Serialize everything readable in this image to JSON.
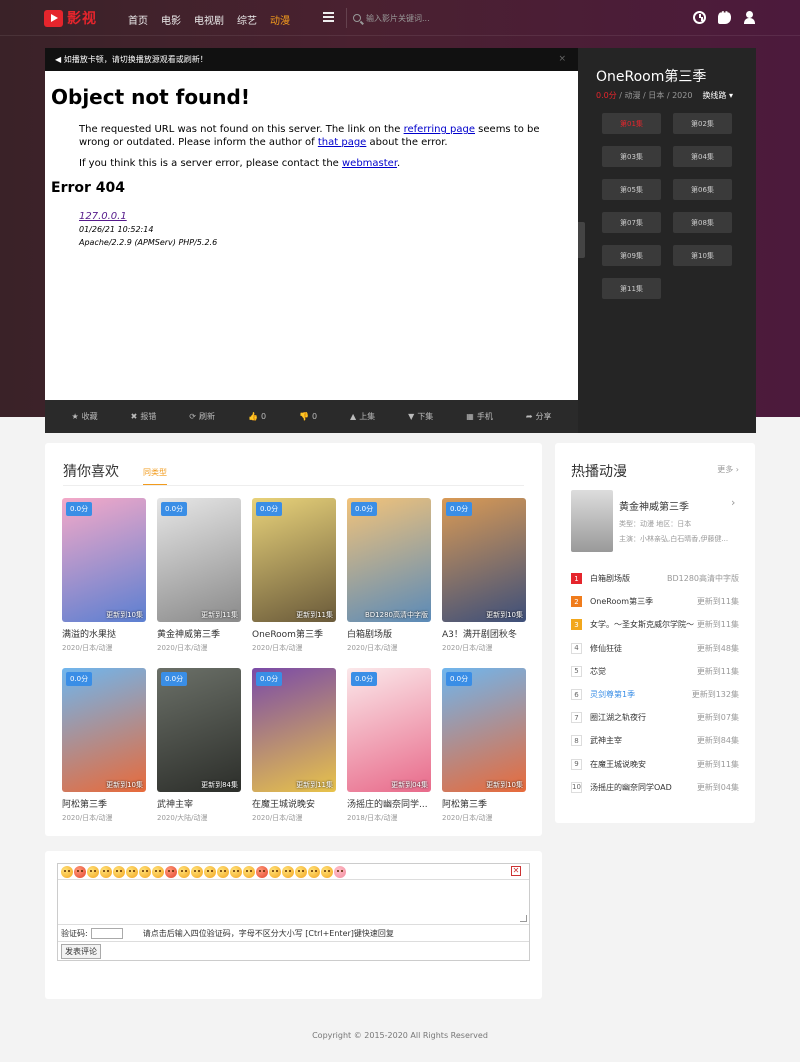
{
  "header": {
    "logo_text": "影视",
    "nav": [
      {
        "label": "首页",
        "active": false
      },
      {
        "label": "电影",
        "active": false
      },
      {
        "label": "电视剧",
        "active": false
      },
      {
        "label": "综艺",
        "active": false
      },
      {
        "label": "动漫",
        "active": true
      }
    ],
    "search_placeholder": "输入影片关键词..."
  },
  "player": {
    "notice": "◀ 如播放卡顿，请切换播放源观看或刷新！",
    "close": "×",
    "error": {
      "title": "Object not found!",
      "p1_a": "The requested URL was not found on this server. The link on the ",
      "p1_link1": "referring page",
      "p1_b": " seems to be wrong or outdated. Please inform the author of ",
      "p1_link2": "that page",
      "p1_c": " about the error.",
      "p2_a": "If you think this is a server error, please contact the ",
      "p2_link": "webmaster",
      "p2_b": ".",
      "code": "Error 404",
      "host": "127.0.0.1",
      "date": "01/26/21 10:52:14",
      "server": "Apache/2.2.9 (APMServ) PHP/5.2.6"
    },
    "toolbar": [
      {
        "icon": "star-icon",
        "glyph": "★",
        "label": "收藏"
      },
      {
        "icon": "warning-icon",
        "glyph": "✖",
        "label": "报错"
      },
      {
        "icon": "refresh-icon",
        "glyph": "⟳",
        "label": "刷新"
      },
      {
        "icon": "thumbs-up-icon",
        "glyph": "👍",
        "label": "0"
      },
      {
        "icon": "thumbs-down-icon",
        "glyph": "👎",
        "label": "0"
      },
      {
        "icon": "up-icon",
        "glyph": "▲",
        "label": "上集"
      },
      {
        "icon": "down-icon",
        "glyph": "▼",
        "label": "下集"
      },
      {
        "icon": "qrcode-icon",
        "glyph": "▦",
        "label": "手机"
      },
      {
        "icon": "share-icon",
        "glyph": "➦",
        "label": "分享"
      }
    ]
  },
  "episodes": {
    "title": "OneRoom第三季",
    "score": "0.0分",
    "meta": " / 动漫 / 日本 / 2020",
    "switch_label": "换线路 ▾",
    "items": [
      "第01集",
      "第02集",
      "第03集",
      "第04集",
      "第05集",
      "第06集",
      "第07集",
      "第08集",
      "第09集",
      "第10集",
      "第11集"
    ],
    "current_index": 0
  },
  "guess": {
    "title": "猜你喜欢",
    "tab": "同类型",
    "cards": [
      {
        "score": "0.0分",
        "update": "更新到10集",
        "name": "满溢的水果挞",
        "meta": "2020/日本/动漫",
        "colors": [
          "#f4a9c8",
          "#5b7fd1"
        ]
      },
      {
        "score": "0.0分",
        "update": "更新到11集",
        "name": "黄金神威第三季",
        "meta": "2020/日本/动漫",
        "colors": [
          "#e6e6e6",
          "#8a8a8a"
        ]
      },
      {
        "score": "0.0分",
        "update": "更新到11集",
        "name": "OneRoom第三季",
        "meta": "2020/日本/动漫",
        "colors": [
          "#e8d27a",
          "#6a5a3a"
        ]
      },
      {
        "score": "0.0分",
        "update": "BD1280高清中字版",
        "name": "白箱剧场版",
        "meta": "2020/日本/动漫",
        "colors": [
          "#f2c37a",
          "#5a8ab8"
        ]
      },
      {
        "score": "0.0分",
        "update": "更新到10集",
        "name": "A3！满开剧团秋冬",
        "meta": "2020/日本/动漫",
        "colors": [
          "#d99a55",
          "#3d4f7a"
        ]
      },
      {
        "score": "0.0分",
        "update": "更新到10集",
        "name": "阿松第三季",
        "meta": "2020/日本/动漫",
        "colors": [
          "#6fb6ee",
          "#e86a3a"
        ]
      },
      {
        "score": "0.0分",
        "update": "更新到84集",
        "name": "武神主宰",
        "meta": "2020/大陆/动漫",
        "colors": [
          "#6b7068",
          "#2c2e2a"
        ]
      },
      {
        "score": "0.0分",
        "update": "更新到11集",
        "name": "在魔王城说晚安",
        "meta": "2020/日本/动漫",
        "colors": [
          "#7a4aa8",
          "#e8c34a"
        ]
      },
      {
        "score": "0.0分",
        "update": "更新到04集",
        "name": "汤摇庄的幽奈同学...",
        "meta": "2018/日本/动漫",
        "colors": [
          "#fbe8ea",
          "#e86a8a"
        ]
      },
      {
        "score": "0.0分",
        "update": "更新到10集",
        "name": "阿松第三季",
        "meta": "2020/日本/动漫",
        "colors": [
          "#6fb6ee",
          "#e86a3a"
        ]
      }
    ]
  },
  "hot": {
    "title": "热播动漫",
    "more": "更多 ›",
    "featured": {
      "name": "黄金神威第三季",
      "arrow": "›",
      "line1": "类型：动漫 地区：日本",
      "line2": "主演：小林亲弘,白石晴香,伊藤健..."
    },
    "list": [
      {
        "num": "1",
        "name": "白箱剧场版",
        "status": "BD1280高清中字版",
        "blue": false
      },
      {
        "num": "2",
        "name": "OneRoom第三季",
        "status": "更新到11集",
        "blue": false
      },
      {
        "num": "3",
        "name": "女学。～圣女斯克威尔学院～",
        "status": "更新到11集",
        "blue": false
      },
      {
        "num": "4",
        "name": "修仙狂徒",
        "status": "更新到48集",
        "blue": false
      },
      {
        "num": "5",
        "name": "芯觉",
        "status": "更新到11集",
        "blue": false
      },
      {
        "num": "6",
        "name": "灵剑尊第1季",
        "status": "更新到132集",
        "blue": true
      },
      {
        "num": "7",
        "name": "圈江湖之轨夜行",
        "status": "更新到07集",
        "blue": false
      },
      {
        "num": "8",
        "name": "武神主宰",
        "status": "更新到84集",
        "blue": false
      },
      {
        "num": "9",
        "name": "在魔王城说晚安",
        "status": "更新到11集",
        "blue": false
      },
      {
        "num": "10",
        "name": "汤摇庄的幽奈同学OAD",
        "status": "更新到04集",
        "blue": false
      }
    ]
  },
  "comment": {
    "verify_label": "验证码:",
    "verify_tip": "请点击后输入四位验证码，字母不区分大小写 [Ctrl+Enter]键快速回复",
    "submit": "发表评论",
    "close": "✕"
  },
  "footer": {
    "text": "Copyright © 2015-2020 All Rights Reserved"
  }
}
